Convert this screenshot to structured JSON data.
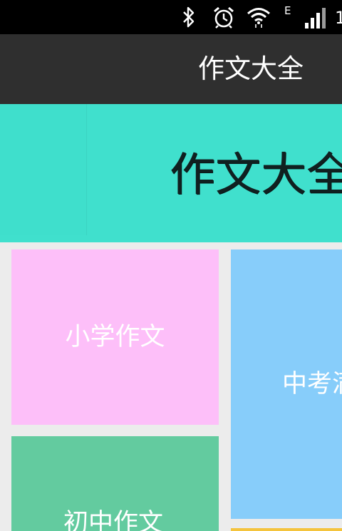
{
  "status_bar": {
    "icons": [
      "bluetooth-icon",
      "alarm-icon",
      "wifi-icon",
      "signal-icon"
    ],
    "network_type": "E",
    "clock_partial": "1"
  },
  "action_bar": {
    "title": "作文大全"
  },
  "banner": {
    "title": "作文大全"
  },
  "tiles": [
    {
      "label": "小学作文",
      "color": "#fdbff9"
    },
    {
      "label": "初中作文",
      "color": "#63cb9f"
    },
    {
      "label": "中考满",
      "color": "#87cdfa"
    },
    {
      "label": "",
      "color": "#f4c43e"
    }
  ],
  "colors": {
    "status_bar": "#000000",
    "action_bar": "#2f2f2f",
    "banner": "#40e0cd",
    "background": "#ececec"
  }
}
